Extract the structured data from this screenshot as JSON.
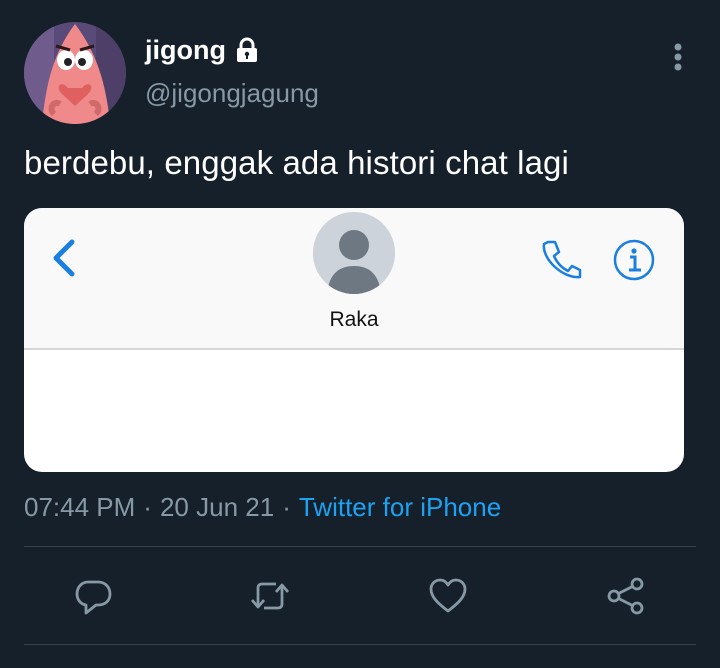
{
  "author": {
    "display_name": "jigong",
    "handle": "@jigongjagung",
    "avatar_icon": "patrick-star-avatar",
    "protected_icon": "lock-icon"
  },
  "tweet": {
    "text": "berdebu, enggak ada histori chat lagi",
    "time": "07:44 PM",
    "date": "20 Jun 21",
    "separator": "·",
    "source": "Twitter for iPhone"
  },
  "media": {
    "contact_name": "Raka",
    "icons": [
      "chevron-left-icon",
      "person-icon",
      "phone-icon",
      "info-icon"
    ]
  },
  "actions": [
    {
      "name": "reply",
      "icon": "reply-icon"
    },
    {
      "name": "retweet",
      "icon": "retweet-icon"
    },
    {
      "name": "like",
      "icon": "heart-icon"
    },
    {
      "name": "share",
      "icon": "share-icon"
    }
  ],
  "colors": {
    "background": "#15202b",
    "text": "#ffffff",
    "secondary_text": "#8899a6",
    "link": "#1da1f2",
    "ios_blue": "#1a7fe0",
    "divider": "#38444d"
  }
}
